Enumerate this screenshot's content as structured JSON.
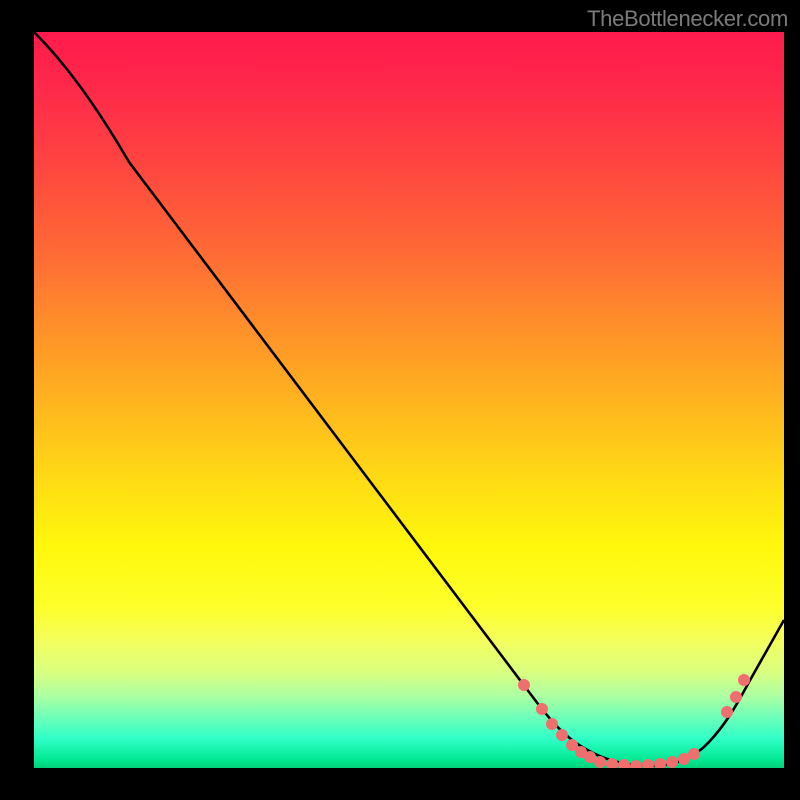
{
  "watermark": "TheBottlenecker.com",
  "chart_data": {
    "type": "line",
    "title": "",
    "xlabel": "",
    "ylabel": "",
    "description": "Bottleneck curve on rainbow gradient background; single black curve descending steeply from top-left, reaching a minimum near x≈0.80, then rising again toward the right edge. Salmon-colored data points cluster around the trough region.",
    "x_range_normalized": [
      0,
      1
    ],
    "y_range_normalized": [
      0,
      1
    ],
    "curve_samples_normalized": [
      {
        "x": 0.0,
        "y": 1.0
      },
      {
        "x": 0.05,
        "y": 0.94
      },
      {
        "x": 0.1,
        "y": 0.85
      },
      {
        "x": 0.15,
        "y": 0.76
      },
      {
        "x": 0.2,
        "y": 0.68
      },
      {
        "x": 0.3,
        "y": 0.54
      },
      {
        "x": 0.4,
        "y": 0.4
      },
      {
        "x": 0.5,
        "y": 0.265
      },
      {
        "x": 0.6,
        "y": 0.14
      },
      {
        "x": 0.66,
        "y": 0.103
      },
      {
        "x": 0.7,
        "y": 0.06
      },
      {
        "x": 0.75,
        "y": 0.02
      },
      {
        "x": 0.8,
        "y": 0.003
      },
      {
        "x": 0.85,
        "y": 0.01
      },
      {
        "x": 0.9,
        "y": 0.05
      },
      {
        "x": 0.95,
        "y": 0.13
      },
      {
        "x": 1.0,
        "y": 0.2
      }
    ],
    "data_points_normalized": [
      {
        "x": 0.653,
        "y": 0.113
      },
      {
        "x": 0.677,
        "y": 0.08
      },
      {
        "x": 0.691,
        "y": 0.06
      },
      {
        "x": 0.704,
        "y": 0.045
      },
      {
        "x": 0.717,
        "y": 0.031
      },
      {
        "x": 0.729,
        "y": 0.022
      },
      {
        "x": 0.741,
        "y": 0.015
      },
      {
        "x": 0.755,
        "y": 0.008
      },
      {
        "x": 0.771,
        "y": 0.005
      },
      {
        "x": 0.787,
        "y": 0.004
      },
      {
        "x": 0.803,
        "y": 0.003
      },
      {
        "x": 0.819,
        "y": 0.004
      },
      {
        "x": 0.835,
        "y": 0.005
      },
      {
        "x": 0.851,
        "y": 0.008
      },
      {
        "x": 0.867,
        "y": 0.012
      },
      {
        "x": 0.88,
        "y": 0.019
      },
      {
        "x": 0.924,
        "y": 0.076
      },
      {
        "x": 0.936,
        "y": 0.097
      },
      {
        "x": 0.947,
        "y": 0.12
      }
    ],
    "gradient_stops": [
      {
        "pos": 0.0,
        "color": "#ff1a4d"
      },
      {
        "pos": 0.3,
        "color": "#ff6a35"
      },
      {
        "pos": 0.6,
        "color": "#ffd815"
      },
      {
        "pos": 0.85,
        "color": "#f3ff60"
      },
      {
        "pos": 1.0,
        "color": "#00d078"
      }
    ],
    "point_color": "#ef6f6f",
    "curve_color": "#000000",
    "background_color": "#000000"
  }
}
